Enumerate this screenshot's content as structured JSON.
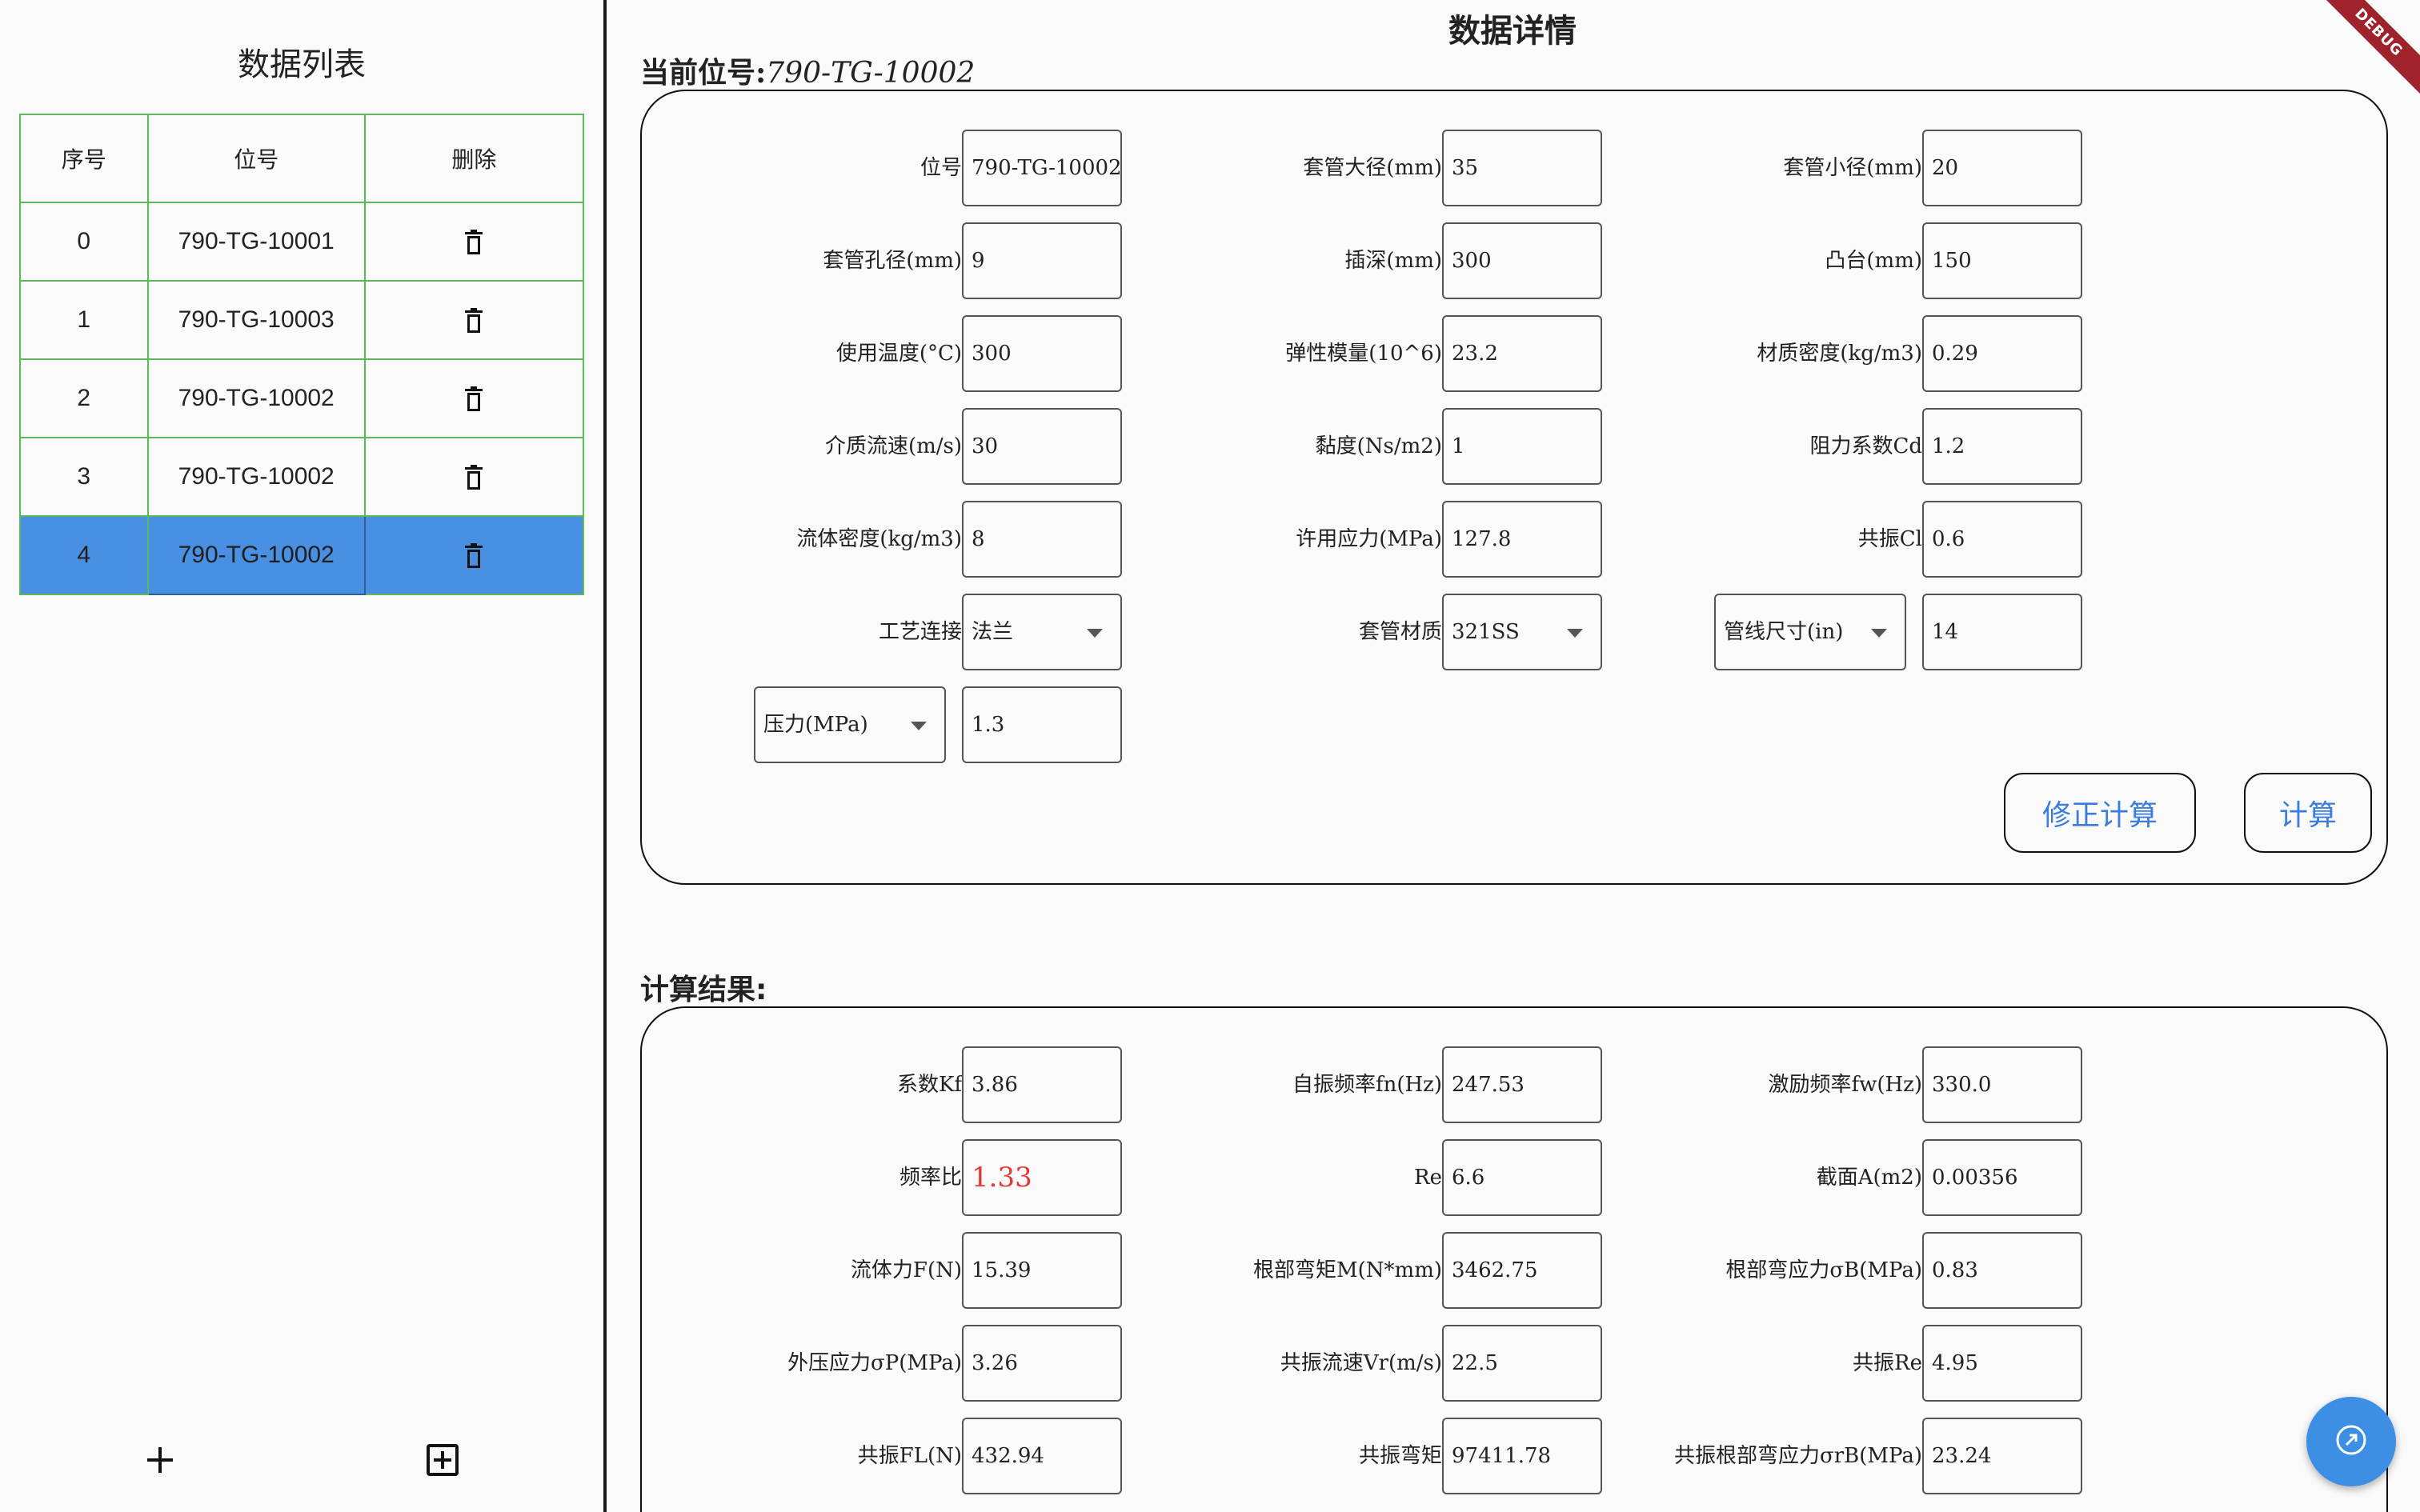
{
  "left": {
    "title": "数据列表",
    "table": {
      "headers": [
        "序号",
        "位号",
        "删除"
      ],
      "rows": [
        {
          "index": "0",
          "tag": "790-TG-10001"
        },
        {
          "index": "1",
          "tag": "790-TG-10003"
        },
        {
          "index": "2",
          "tag": "790-TG-10002"
        },
        {
          "index": "3",
          "tag": "790-TG-10002"
        },
        {
          "index": "4",
          "tag": "790-TG-10002"
        }
      ],
      "selected_index": 4
    },
    "bottom_icons": [
      "add-icon",
      "add-box-icon"
    ]
  },
  "detail": {
    "title": "数据详情",
    "current_label": "当前位号:",
    "current_value": "790-TG-10002",
    "inputs": [
      [
        {
          "label": "位号",
          "value": "790-TG-10002"
        },
        {
          "label": "套管大径(mm)",
          "value": "35"
        },
        {
          "label": "套管小径(mm)",
          "value": "20"
        }
      ],
      [
        {
          "label": "套管孔径(mm)",
          "value": "9"
        },
        {
          "label": "插深(mm)",
          "value": "300"
        },
        {
          "label": "凸台(mm)",
          "value": "150"
        }
      ],
      [
        {
          "label": "使用温度(°C)",
          "value": "300"
        },
        {
          "label": "弹性模量(10^6)",
          "value": "23.2"
        },
        {
          "label": "材质密度(kg/m3)",
          "value": "0.29"
        }
      ],
      [
        {
          "label": "介质流速(m/s)",
          "value": "30"
        },
        {
          "label": "黏度(Ns/m2)",
          "value": "1"
        },
        {
          "label": "阻力系数Cd",
          "value": "1.2"
        }
      ],
      [
        {
          "label": "流体密度(kg/m3)",
          "value": "8"
        },
        {
          "label": "许用应力(MPa)",
          "value": "127.8"
        },
        {
          "label": "共振Cl",
          "value": "0.6"
        }
      ]
    ],
    "process_connection": {
      "label": "工艺连接",
      "value": "法兰"
    },
    "sleeve_material": {
      "label": "套管材质",
      "value": "321SS"
    },
    "pipe_size": {
      "selector": "管线尺寸(in)",
      "value": "14"
    },
    "pressure": {
      "selector": "压力(MPa)",
      "value": "1.3"
    },
    "buttons": {
      "correct": "修正计算",
      "calculate": "计算"
    }
  },
  "results": {
    "title": "计算结果:",
    "rows": [
      [
        {
          "label": "系数Kf",
          "value": "3.86"
        },
        {
          "label": "自振频率fn(Hz)",
          "value": "247.53"
        },
        {
          "label": "激励频率fw(Hz)",
          "value": "330.0"
        }
      ],
      [
        {
          "label": "频率比",
          "value": "1.33"
        },
        {
          "label": "Re",
          "value": "6.6"
        },
        {
          "label": "截面A(m2)",
          "value": "0.00356"
        }
      ],
      [
        {
          "label": "流体力F(N)",
          "value": "15.39"
        },
        {
          "label": "根部弯矩M(N*mm)",
          "value": "3462.75"
        },
        {
          "label": "根部弯应力σB(MPa)",
          "value": "0.83"
        }
      ],
      [
        {
          "label": "外压应力σP(MPa)",
          "value": "3.26"
        },
        {
          "label": "共振流速Vr(m/s)",
          "value": "22.5"
        },
        {
          "label": "共振Re",
          "value": "4.95"
        }
      ],
      [
        {
          "label": "共振FL(N)",
          "value": "432.94"
        },
        {
          "label": "共振弯矩",
          "value": "97411.78"
        },
        {
          "label": "共振根部弯应力σrB(MPa)",
          "value": "23.24"
        }
      ]
    ],
    "highlight_color": "#e53935"
  },
  "debug_banner": "DEBUG",
  "colors": {
    "accent": "#4a90e2",
    "table_border": "#5cb85c",
    "button_text": "#3b7ddb"
  }
}
